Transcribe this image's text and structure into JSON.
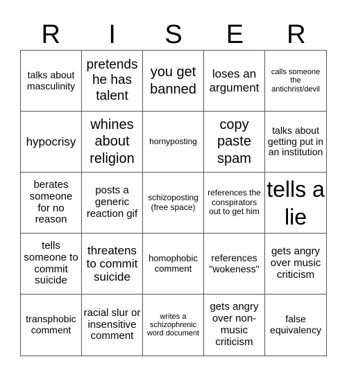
{
  "title_letters": [
    "R",
    "I",
    "S",
    "E",
    "R"
  ],
  "cells": [
    [
      "talks about masculinity",
      "pretends he has talent",
      "you get banned",
      "loses an argument",
      "calls someone the antichrist/devil"
    ],
    [
      "hypocrisy",
      "whines about religion",
      "hornyposting",
      "copy paste spam",
      "talks about getting put in an institution"
    ],
    [
      "berates someone for no reason",
      "posts a generic reaction gif",
      "schizoposting (free space)",
      "references the conspirators out to get him",
      "tells a lie"
    ],
    [
      "tells someone to commit suicide",
      "threatens to commit suicide",
      "homophobic comment",
      "references \"wokeness\"",
      "gets angry over music criticism"
    ],
    [
      "transphobic comment",
      "racial slur or insensitive comment",
      "writes a schizophrenic word document",
      "gets angry over non-music criticism",
      "false equivalency"
    ]
  ]
}
